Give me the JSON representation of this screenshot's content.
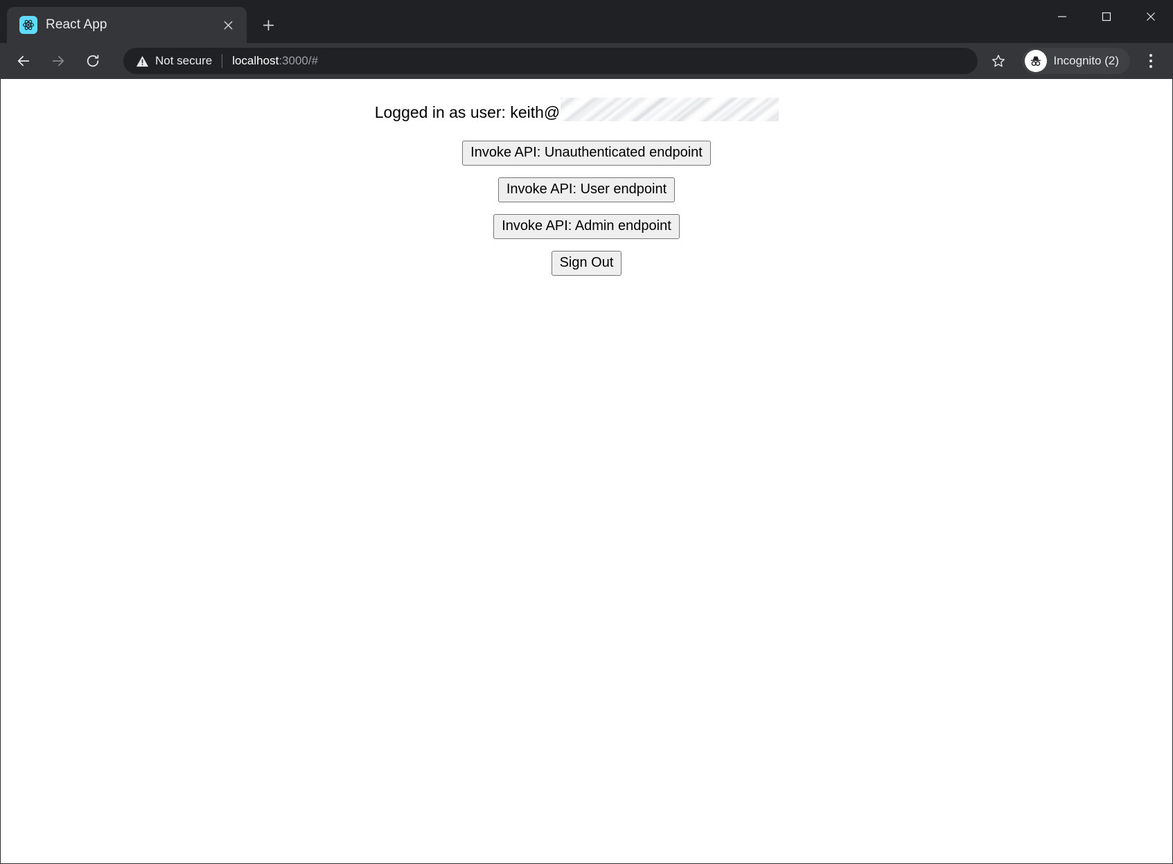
{
  "window": {
    "minimize_label": "Minimize",
    "maximize_label": "Maximize",
    "close_label": "Close"
  },
  "tabstrip": {
    "tabs": [
      {
        "title": "React App",
        "favicon": "react-logo-icon",
        "close_label": "Close tab"
      }
    ],
    "new_tab_label": "New Tab"
  },
  "toolbar": {
    "back_label": "Back",
    "forward_label": "Forward",
    "reload_label": "Reload this page",
    "bookmark_label": "Bookmark this tab",
    "menu_label": "Customize and control Google Chrome",
    "omnibox": {
      "security_text": "Not secure",
      "security_icon": "warning-triangle-icon",
      "url_host": "localhost",
      "url_rest": ":3000/#",
      "full_url": "localhost:3000/#"
    },
    "profile": {
      "label": "Incognito (2)",
      "icon": "incognito-hat-glasses-icon"
    }
  },
  "page": {
    "status_prefix": "Logged in as user: keith@",
    "status_redacted": true,
    "buttons": [
      {
        "label": "Invoke API: Unauthenticated endpoint",
        "name": "invoke-unauthenticated-endpoint-button"
      },
      {
        "label": "Invoke API: User endpoint",
        "name": "invoke-user-endpoint-button"
      },
      {
        "label": "Invoke API: Admin endpoint",
        "name": "invoke-admin-endpoint-button"
      },
      {
        "label": "Sign Out",
        "name": "sign-out-button"
      }
    ]
  },
  "colors": {
    "chrome_dark": "#202124",
    "tab_active": "#35363a",
    "react_blue": "#61dafb",
    "text_light": "#e8eaed",
    "url_dim": "#9aa0a6",
    "button_face": "#efefef",
    "button_border": "#767676"
  }
}
